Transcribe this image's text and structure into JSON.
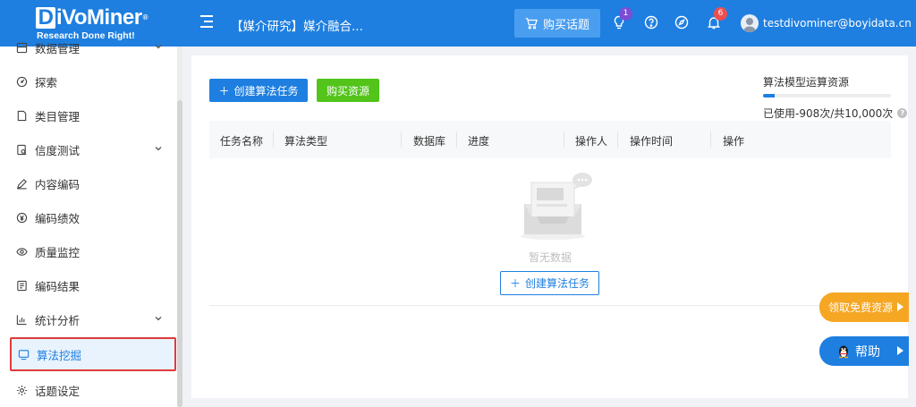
{
  "header": {
    "logo_text": "DiVoMiner",
    "logo_tagline": "Research Done Right!",
    "project_title": "【媒介研究】媒介融合...",
    "buy_topic_label": "购买话题",
    "notification_badges": {
      "bulb": "1",
      "bell": "6"
    },
    "user_email": "testdivominer@boyidata.cn",
    "colors": {
      "primary": "#1e7fe0"
    }
  },
  "sidebar": {
    "items": [
      {
        "label": "数据管理",
        "icon": "database-icon",
        "has_children": true
      },
      {
        "label": "探索",
        "icon": "compass-icon",
        "has_children": false
      },
      {
        "label": "类目管理",
        "icon": "document-icon",
        "has_children": false
      },
      {
        "label": "信度测试",
        "icon": "test-icon",
        "has_children": true
      },
      {
        "label": "内容编码",
        "icon": "pen-icon",
        "has_children": false
      },
      {
        "label": "编码绩效",
        "icon": "yen-icon",
        "has_children": false
      },
      {
        "label": "质量监控",
        "icon": "eye-icon",
        "has_children": false
      },
      {
        "label": "编码结果",
        "icon": "result-icon",
        "has_children": false
      },
      {
        "label": "统计分析",
        "icon": "bar-chart-icon",
        "has_children": true
      },
      {
        "label": "算法挖掘",
        "icon": "monitor-icon",
        "has_children": false,
        "active": true
      },
      {
        "label": "话题设定",
        "icon": "gear-icon",
        "has_children": false
      }
    ]
  },
  "toolbar": {
    "create_task_label": "创建算法任务",
    "buy_resource_label": "购买资源"
  },
  "quota": {
    "title": "算法模型运算资源",
    "usage_text": "已使用-908次/共10,000次",
    "used": 908,
    "total": 10000
  },
  "table": {
    "columns": [
      "任务名称",
      "算法类型",
      "数据库",
      "进度",
      "操作人",
      "操作时间",
      "操作"
    ],
    "rows": [],
    "empty_text": "暂无数据",
    "empty_create_label": "创建算法任务"
  },
  "floating": {
    "free_resource_label": "领取免费资源",
    "help_label": "帮助"
  }
}
